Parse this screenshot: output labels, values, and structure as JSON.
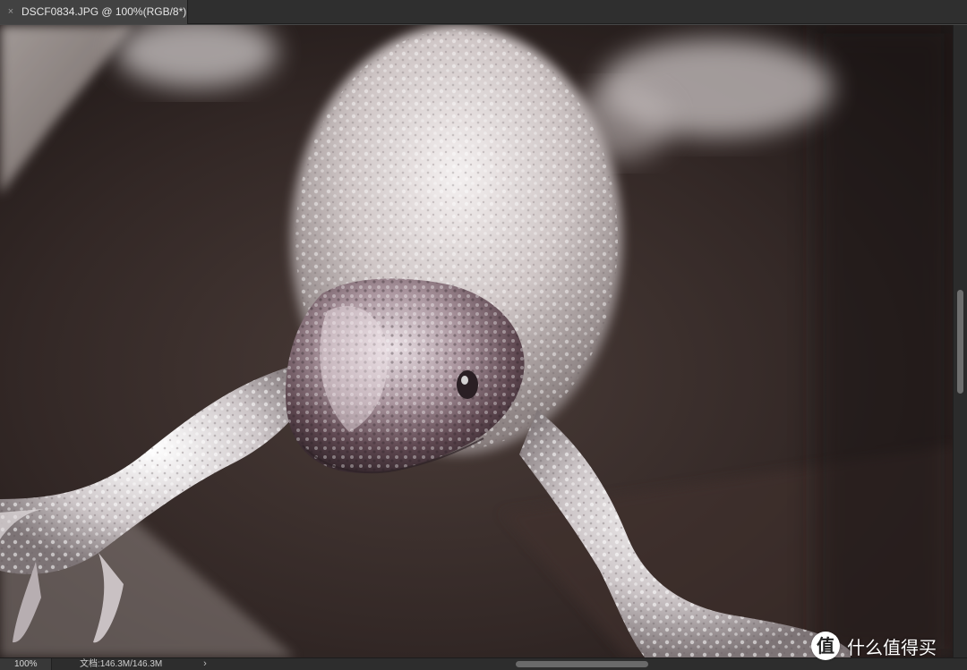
{
  "app": {
    "colors": {
      "tab_bar": "#2f2f2f",
      "active_tab": "#424242",
      "status_bar": "#2d2d2d",
      "scroll_thumb": "#6e6e6e"
    }
  },
  "tab": {
    "close_glyph": "×",
    "title": "DSCF0834.JPG @ 100%(RGB/8*)"
  },
  "canvas": {
    "subject": "photo-of-silver-crystal-lizard-sculpture"
  },
  "status": {
    "zoom": "100%",
    "doc_info": "文档:146.3M/146.3M",
    "arrow_glyph": "›"
  },
  "watermark": {
    "logo_glyph": "值",
    "text": "什么值得买"
  }
}
